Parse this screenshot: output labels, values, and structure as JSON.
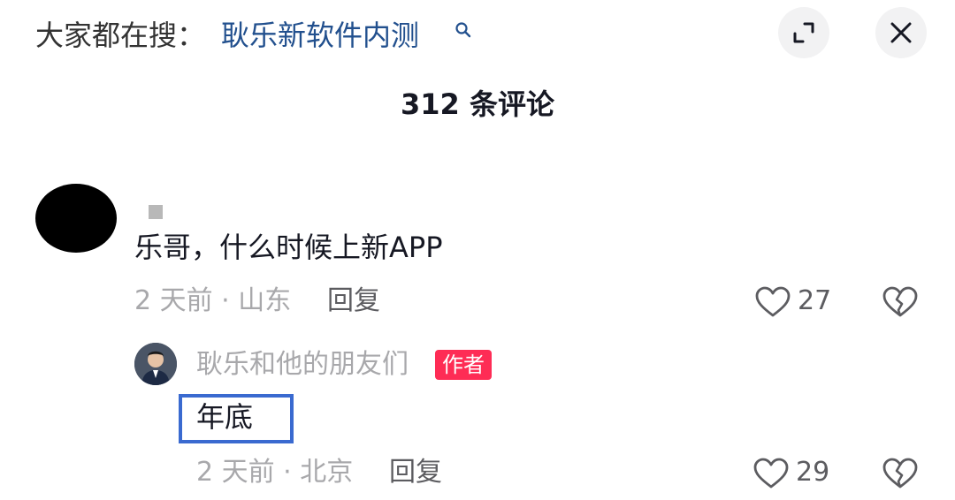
{
  "search_bar": {
    "prefix": "大家都在搜：",
    "query": "耿乐新软件内测"
  },
  "comments_header": {
    "title": "312 条评论"
  },
  "comment": {
    "text": "乐哥，什么时候上新APP",
    "meta": "2 天前 · 山东",
    "reply_label": "回复",
    "likes": "27"
  },
  "reply": {
    "author": "耿乐和他的朋友们",
    "badge": "作者",
    "text": "年底",
    "meta": "2 天前 · 北京",
    "reply_label": "回复",
    "likes": "29"
  },
  "colors": {
    "link_blue": "#22508e",
    "author_badge": "#fe2c55",
    "highlight_box": "#3a6ad0"
  },
  "icons": [
    "search-icon",
    "expand-icon",
    "close-icon",
    "heart-icon",
    "dislike-icon"
  ]
}
